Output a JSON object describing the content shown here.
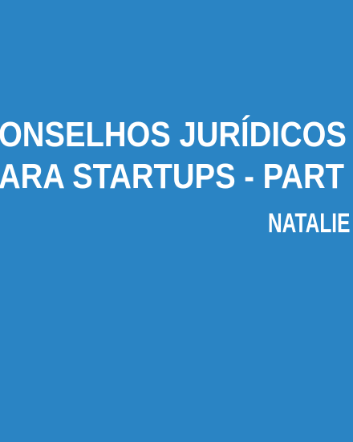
{
  "background_color": "#2a84c4",
  "title": {
    "line1": "ONSELHOS JURÍDICOS",
    "line2": "ARA STARTUPS - PART"
  },
  "author": "NATALIE B"
}
